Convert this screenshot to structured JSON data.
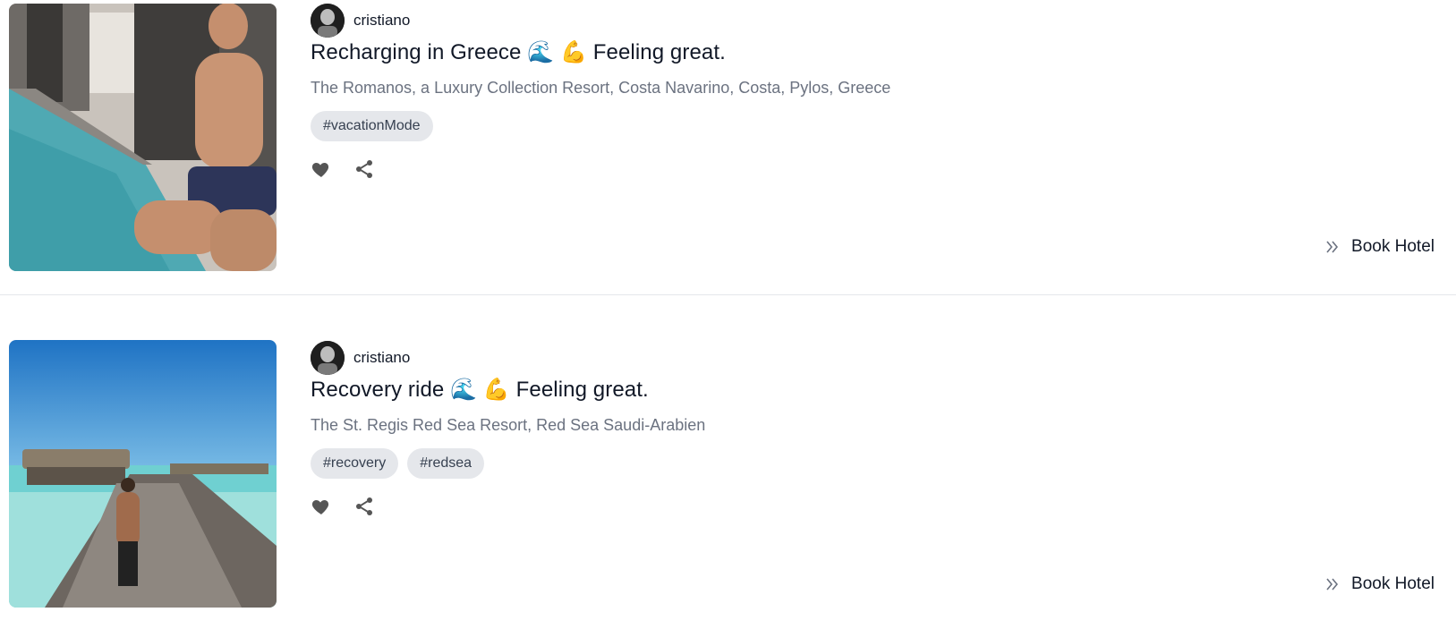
{
  "posts": [
    {
      "author": {
        "name": "cristiano",
        "avatar_icon": "profile-photo"
      },
      "image_icon": "pool-photo",
      "title": "Recharging in Greece 🌊 💪 Feeling great.",
      "location": "The Romanos, a Luxury Collection Resort, Costa Navarino, Costa, Pylos, Greece",
      "tags": [
        "#vacationMode"
      ],
      "actions": {
        "like_icon": "heart-icon",
        "share_icon": "share-icon"
      },
      "book_label": "Book Hotel",
      "book_icon": "double-chevron-right-icon"
    },
    {
      "author": {
        "name": "cristiano",
        "avatar_icon": "profile-photo"
      },
      "image_icon": "boardwalk-photo",
      "title": "Recovery ride 🌊 💪 Feeling great.",
      "location": "The St. Regis Red Sea Resort, Red Sea Saudi-Arabien",
      "tags": [
        "#recovery",
        "#redsea"
      ],
      "actions": {
        "like_icon": "heart-icon",
        "share_icon": "share-icon"
      },
      "book_label": "Book Hotel",
      "book_icon": "double-chevron-right-icon"
    }
  ],
  "colors": {
    "text_primary": "#111827",
    "text_muted": "#6b7280",
    "tag_bg": "#e5e7eb",
    "icon": "#555555"
  }
}
